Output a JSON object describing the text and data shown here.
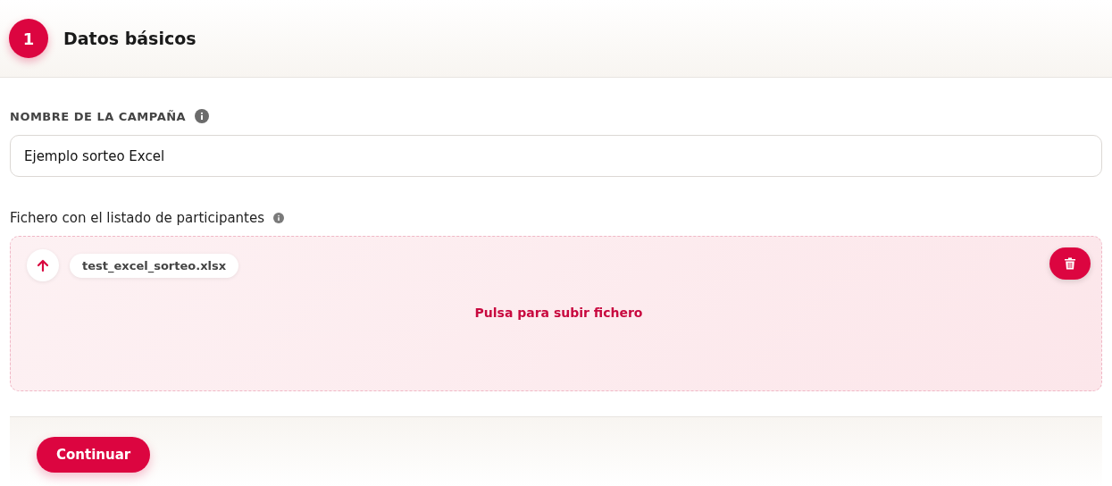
{
  "step": {
    "number": "1",
    "title": "Datos básicos"
  },
  "campaign_field": {
    "label": "NOMBRE DE LA CAMPAÑA",
    "value": "Ejemplo sorteo Excel"
  },
  "file_field": {
    "label": "Fichero con el listado de participantes",
    "file_name": "test_excel_sorteo.xlsx",
    "prompt": "Pulsa para subir fichero"
  },
  "buttons": [
    "Continuar"
  ]
}
